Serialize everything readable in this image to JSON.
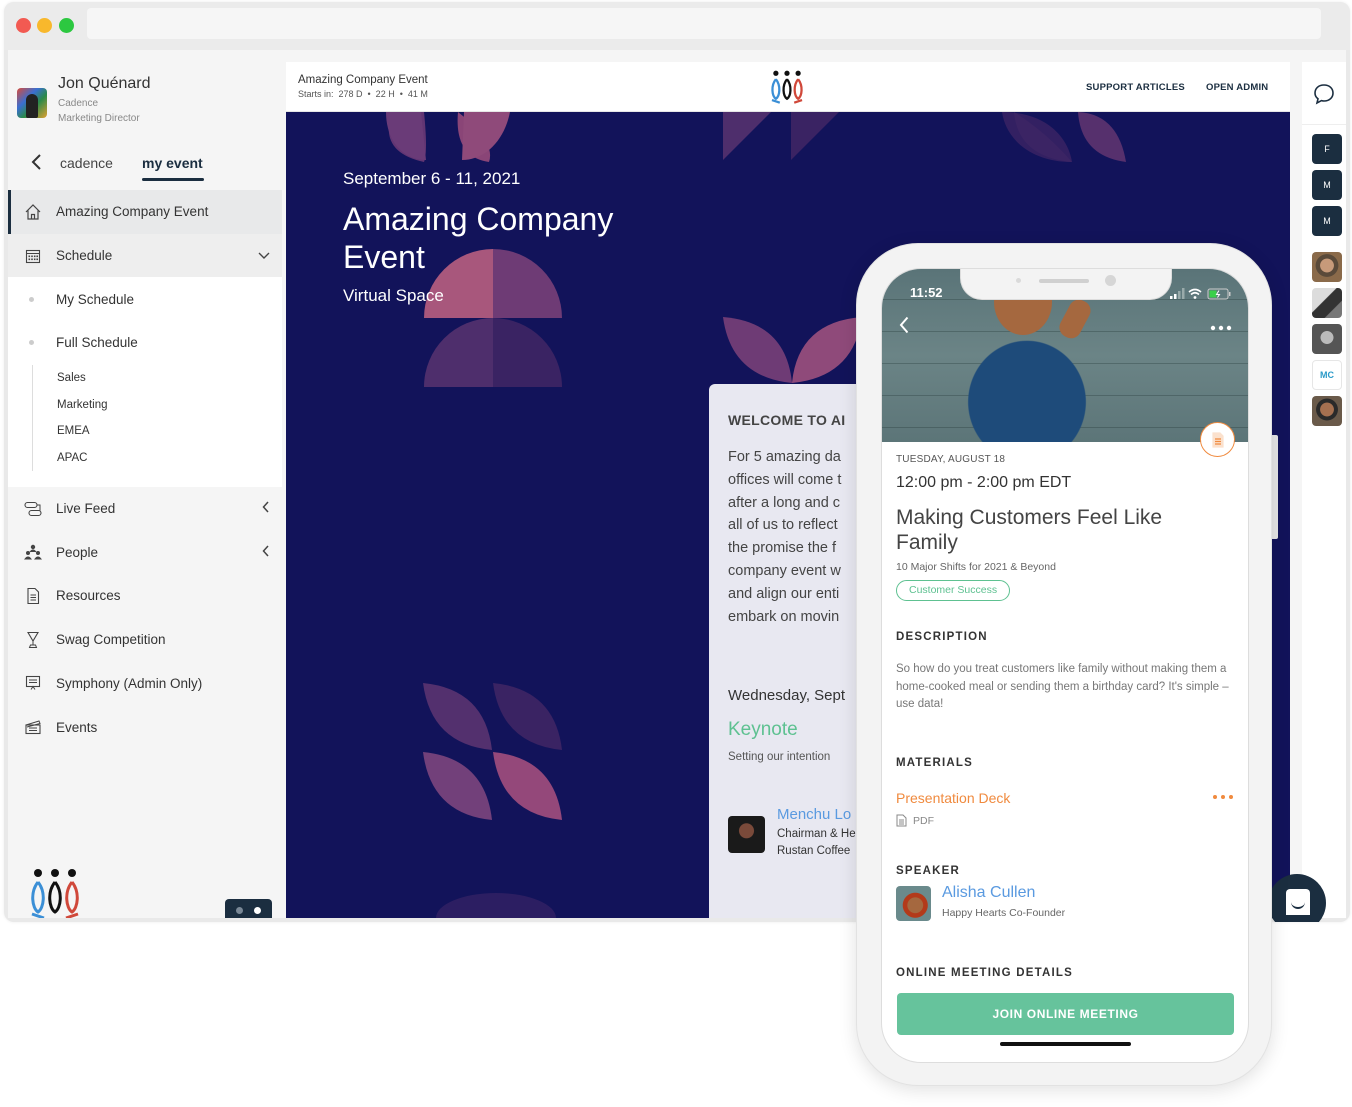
{
  "colors": {
    "navy": "#1b2e40",
    "hero_bg": "#12135a",
    "accent_green": "#5ec191",
    "join_green": "#66c39c",
    "accent_orange": "#f08a3e",
    "link_blue": "#5a9ae0"
  },
  "window": {
    "traffic_lights": [
      "close",
      "minimize",
      "maximize"
    ]
  },
  "profile": {
    "name": "Jon Quénard",
    "organization": "Cadence",
    "role": "Marketing Director",
    "avatar_icon": "user-avatar"
  },
  "tabs": {
    "back_icon": "chevron-left-icon",
    "items": [
      {
        "label": "cadence",
        "active": false
      },
      {
        "label": "my event",
        "active": true
      }
    ]
  },
  "sidebar": {
    "items": [
      {
        "label": "Amazing Company Event",
        "icon": "home-icon",
        "active": true
      },
      {
        "label": "Schedule",
        "icon": "calendar-icon",
        "arrow": "chevron-down",
        "expanded": true
      },
      {
        "label": "Live Feed",
        "icon": "feed-icon",
        "arrow": "chevron-left"
      },
      {
        "label": "People",
        "icon": "people-icon",
        "arrow": "chevron-left"
      },
      {
        "label": "Resources",
        "icon": "document-icon"
      },
      {
        "label": "Swag Competition",
        "icon": "trophy-icon"
      },
      {
        "label": "Symphony (Admin Only)",
        "icon": "presentation-icon"
      },
      {
        "label": "Events",
        "icon": "clapperboard-icon"
      }
    ],
    "schedule_children": [
      {
        "label": "My Schedule"
      },
      {
        "label": "Full Schedule",
        "children": [
          "Sales",
          "Marketing",
          "EMEA",
          "APAC"
        ]
      }
    ]
  },
  "header": {
    "event_title": "Amazing Company Event",
    "countdown_label": "Starts in:",
    "countdown": {
      "days": "278 D",
      "hours": "22 H",
      "minutes": "41 M"
    },
    "countdown_text": "Starts in:  278 D  •  22 H  •  41 M",
    "links": [
      "SUPPORT ARTICLES",
      "OPEN ADMIN"
    ]
  },
  "hero": {
    "date_range": "September 6 - 11, 2021",
    "title": "Amazing Company Event",
    "venue": "Virtual Space"
  },
  "welcome_card": {
    "heading": "WELCOME TO AI",
    "body_lines": [
      "For 5 amazing da",
      "offices will come t",
      "after a long and c",
      "all of us to reflect",
      "the promise the f",
      "company event w",
      "and align our enti",
      "embark on movin"
    ],
    "day": "Wednesday, Sept",
    "session_title": "Keynote",
    "session_subtitle": "Setting our intention",
    "speaker": {
      "name": "Menchu Lo",
      "title": "Chairman & He",
      "organization": "Rustan Coffee"
    }
  },
  "right_rail": {
    "chat_icon": "chat-bubble-icon",
    "badges": [
      "F",
      "M",
      "M"
    ],
    "photos": [
      "attendee-1",
      "attendee-2",
      "attendee-3",
      "MC",
      "attendee-5"
    ]
  },
  "phone": {
    "status_time": "11:52",
    "date": "TUESDAY, AUGUST 18",
    "time": "12:00 pm - 2:00 pm EDT",
    "title": "Making Customers Feel Like Family",
    "subtitle": "10 Major Shifts for 2021 & Beyond",
    "tag": "Customer Success",
    "description_heading": "DESCRIPTION",
    "description": "So how do you treat customers like family without making them a home-cooked meal or sending them a birthday card? It's simple – use data!",
    "materials_heading": "MATERIALS",
    "material": {
      "name": "Presentation Deck",
      "type": "PDF"
    },
    "speaker_heading": "SPEAKER",
    "speaker": {
      "name": "Alisha Cullen",
      "role": "Happy Hearts Co-Founder"
    },
    "meeting_heading": "ONLINE MEETING DETAILS",
    "join_button": "JOIN ONLINE MEETING"
  }
}
